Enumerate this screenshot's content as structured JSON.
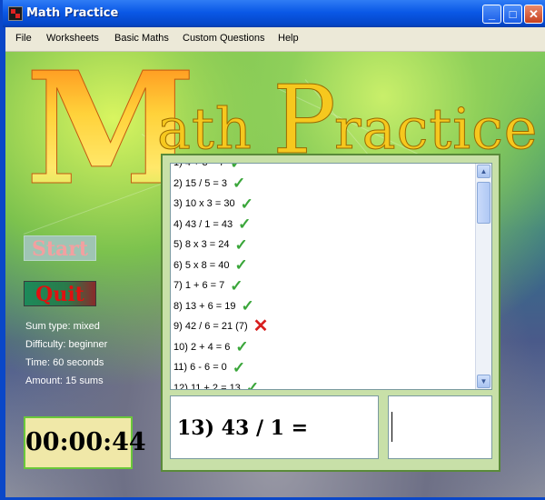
{
  "window": {
    "title": "Math Practice"
  },
  "menu": [
    "File",
    "Worksheets",
    "Basic Maths",
    "Custom Questions",
    "Help"
  ],
  "logo": {
    "first_letter": "M",
    "part1": "ath",
    "p_letter": "P",
    "part2": "ractice"
  },
  "buttons": {
    "start": "Start",
    "quit": "Quit"
  },
  "info": {
    "sum_type": "Sum type: mixed",
    "difficulty": "Difficulty: beginner",
    "time": "Time: 60 seconds",
    "amount": "Amount: 15 sums"
  },
  "timer": "00:00:44",
  "results": [
    {
      "text": "2) 15 / 5 = 3",
      "correct": true
    },
    {
      "text": "3) 10 x 3 = 30",
      "correct": true
    },
    {
      "text": "4) 43 / 1 = 43",
      "correct": true
    },
    {
      "text": "5) 8 x 3 = 24",
      "correct": true
    },
    {
      "text": "6) 5 x 8 = 40",
      "correct": true
    },
    {
      "text": "7) 1 + 6 = 7",
      "correct": true
    },
    {
      "text": "8) 13 + 6 = 19",
      "correct": true
    },
    {
      "text": "9) 42 / 6 = 21 (7)",
      "correct": false
    },
    {
      "text": "10) 2 + 4 = 6",
      "correct": true
    },
    {
      "text": "11) 6 - 6 = 0",
      "correct": true
    },
    {
      "text": "12) 11 + 2 = 13",
      "correct": true
    }
  ],
  "question": "13) 43 / 1 =",
  "answer": "",
  "colors": {
    "correct": "#3aa63a",
    "wrong": "#d81e1e",
    "titlebar": "#0a58e6"
  }
}
